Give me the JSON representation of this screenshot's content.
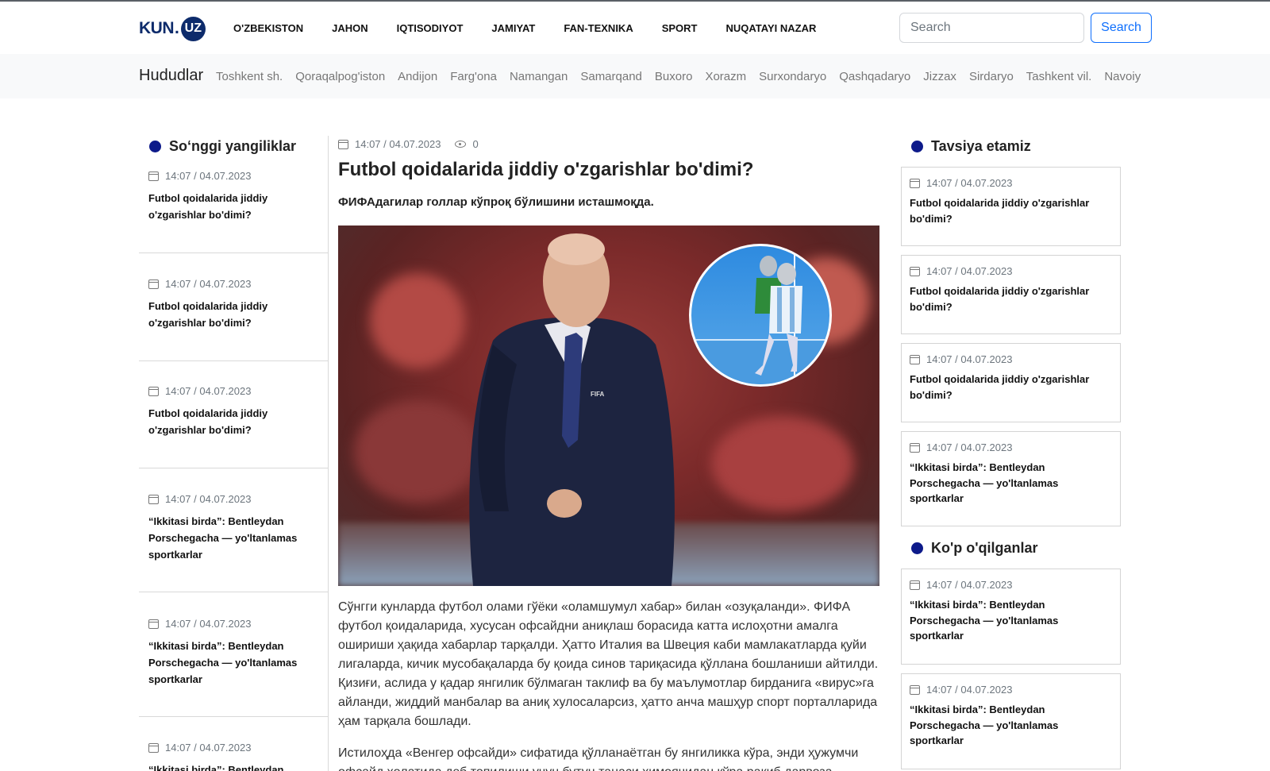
{
  "header": {
    "logo": {
      "text_kun": "KUN",
      "text_dot": ".",
      "text_uz": "UZ"
    },
    "nav": [
      "O'ZBEKISTON",
      "JAHON",
      "IQTISODIYOT",
      "JAMIYAT",
      "FAN-TEXNIKA",
      "SPORT",
      "NUQATAYI NAZAR"
    ],
    "search_placeholder": "Search",
    "search_button": "Search"
  },
  "regions": {
    "title": "Hududlar",
    "items": [
      "Toshkent sh.",
      "Qoraqalpog'iston",
      "Andijon",
      "Farg'ona",
      "Namangan",
      "Samarqand",
      "Buxoro",
      "Xorazm",
      "Surxondaryo",
      "Qashqadaryo",
      "Jizzax",
      "Sirdaryo",
      "Tashkent vil.",
      "Navoiy"
    ]
  },
  "latest": {
    "title": "So‘nggi yangiliklar",
    "items": [
      {
        "date": "14:07 / 04.07.2023",
        "title": "Futbol qoidalarida jiddiy o'zgarishlar bo'dimi?"
      },
      {
        "date": "14:07 / 04.07.2023",
        "title": "Futbol qoidalarida jiddiy o'zgarishlar bo'dimi?"
      },
      {
        "date": "14:07 / 04.07.2023",
        "title": "Futbol qoidalarida jiddiy o'zgarishlar bo'dimi?"
      },
      {
        "date": "14:07 / 04.07.2023",
        "title": "“Ikkitasi birda”: Bentleydan Porschegacha — yo'ltanlamas sportkarlar"
      },
      {
        "date": "14:07 / 04.07.2023",
        "title": "“Ikkitasi birda”: Bentleydan Porschegacha — yo'ltanlamas sportkarlar"
      },
      {
        "date": "14:07 / 04.07.2023",
        "title": "“Ikkitasi birda”: Bentleydan"
      }
    ]
  },
  "article": {
    "date": "14:07 / 04.07.2023",
    "views": "0",
    "headline": "Futbol qoidalarida jiddiy o'zgarishlar bo'dimi?",
    "lead": "ФИФАдагилар голлар кўпроқ бўлишини исташмоқда.",
    "paragraphs": [
      "Сўнгги кунларда футбол олами гўёки «оламшумул хабар» билан «озуқаланди». ФИФА футбол қоидаларида, хусусан офсайдни аниқлаш борасида катта ислоҳотни амалга ошириши ҳақида хабарлар тарқалди. Ҳатто Италия ва Швеция каби мамлакатларда қуйи лигаларда, кичик мусобақаларда бу қоида синов тариқасида қўллана бошланиши айтилди. Қизиғи, аслида у қадар янгилик бўлмаган таклиф ва бу маълумотлар бирданига «вирус»га айланди, жиддий манбалар ва аниқ хулосаларсиз, ҳатто анча машҳур спорт порталларида ҳам тарқала бошлади.",
      "Истилоҳда «Венгер офсайди» сифатида қўлланаётган бу янгиликка кўра, энди ҳужумчи офсайд ҳолатида деб топилиши учун бутун танаси ҳимоячидан кўра рақиб дарвоза"
    ]
  },
  "recommend": {
    "title": "Tavsiya etamiz",
    "items": [
      {
        "date": "14:07 / 04.07.2023",
        "title": "Futbol qoidalarida jiddiy o'zgarishlar bo'dimi?"
      },
      {
        "date": "14:07 / 04.07.2023",
        "title": "Futbol qoidalarida jiddiy o'zgarishlar bo'dimi?"
      },
      {
        "date": "14:07 / 04.07.2023",
        "title": "Futbol qoidalarida jiddiy o'zgarishlar bo'dimi?"
      },
      {
        "date": "14:07 / 04.07.2023",
        "title": "“Ikkitasi birda”: Bentleydan Porschegacha — yo'ltanlamas sportkarlar"
      }
    ]
  },
  "popular": {
    "title": "Ko'p o'qilganlar",
    "items": [
      {
        "date": "14:07 / 04.07.2023",
        "title": "“Ikkitasi birda”: Bentleydan Porschegacha — yo'ltanlamas sportkarlar"
      },
      {
        "date": "14:07 / 04.07.2023",
        "title": "“Ikkitasi birda”: Bentleydan Porschegacha — yo'ltanlamas sportkarlar"
      }
    ]
  },
  "colors": {
    "brand": "#0d2b6b",
    "accent_dot": "#0d1a8a",
    "link_blue": "#0d6efd"
  }
}
